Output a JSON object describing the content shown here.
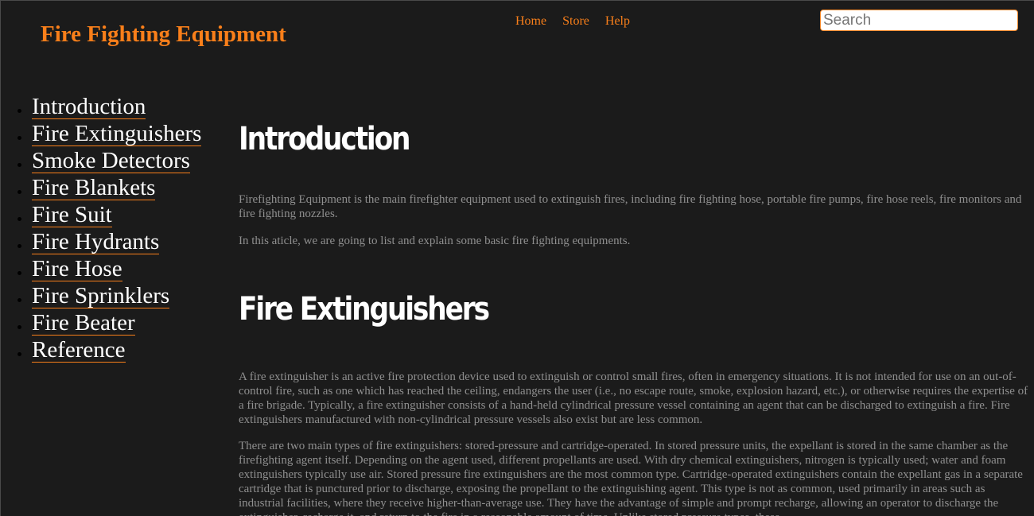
{
  "header": {
    "site_title": "Fire Fighting Equipment",
    "nav": [
      "Home",
      "Store",
      "Help"
    ],
    "search_placeholder": "Search"
  },
  "sidebar": {
    "items": [
      {
        "label": "Introduction"
      },
      {
        "label": "Fire Extinguishers"
      },
      {
        "label": "Smoke Detectors"
      },
      {
        "label": "Fire Blankets"
      },
      {
        "label": "Fire Suit"
      },
      {
        "label": "Fire Hydrants"
      },
      {
        "label": "Fire Hose"
      },
      {
        "label": "Fire Sprinklers"
      },
      {
        "label": "Fire Beater"
      },
      {
        "label": "Reference"
      }
    ]
  },
  "sections": [
    {
      "heading": "Introduction",
      "paragraphs": [
        "Firefighting Equipment is the main firefighter equipment used to extinguish fires, including fire fighting hose, portable fire pumps, fire hose reels, fire monitors and fire fighting nozzles.",
        "In this aticle, we are going to list and explain some basic fire fighting equipments."
      ]
    },
    {
      "heading": "Fire Extinguishers",
      "paragraphs": [
        "A fire extinguisher is an active fire protection device used to extinguish or control small fires, often in emergency situations. It is not intended for use on an out-of-control fire, such as one which has reached the ceiling, endangers the user (i.e., no escape route, smoke, explosion hazard, etc.), or otherwise requires the expertise of a fire brigade. Typically, a fire extinguisher consists of a hand-held cylindrical pressure vessel containing an agent that can be discharged to extinguish a fire. Fire extinguishers manufactured with non-cylindrical pressure vessels also exist but are less common.",
        "There are two main types of fire extinguishers: stored-pressure and cartridge-operated. In stored pressure units, the expellant is stored in the same chamber as the firefighting agent itself. Depending on the agent used, different propellants are used. With dry chemical extinguishers, nitrogen is typically used; water and foam extinguishers typically use air. Stored pressure fire extinguishers are the most common type. Cartridge-operated extinguishers contain the expellant gas in a separate cartridge that is punctured prior to discharge, exposing the propellant to the extinguishing agent. This type is not as common, used primarily in areas such as industrial facilities, where they receive higher-than-average use. They have the advantage of simple and prompt recharge, allowing an operator to discharge the extinguisher, recharge it, and return to the fire in a reasonable amount of time. Unlike stored pressure types, these"
      ]
    }
  ],
  "colors": {
    "background": "#1b1b1b",
    "accent": "#f97f1a",
    "heading": "#ffffff",
    "body_text": "#8f8f8f"
  }
}
